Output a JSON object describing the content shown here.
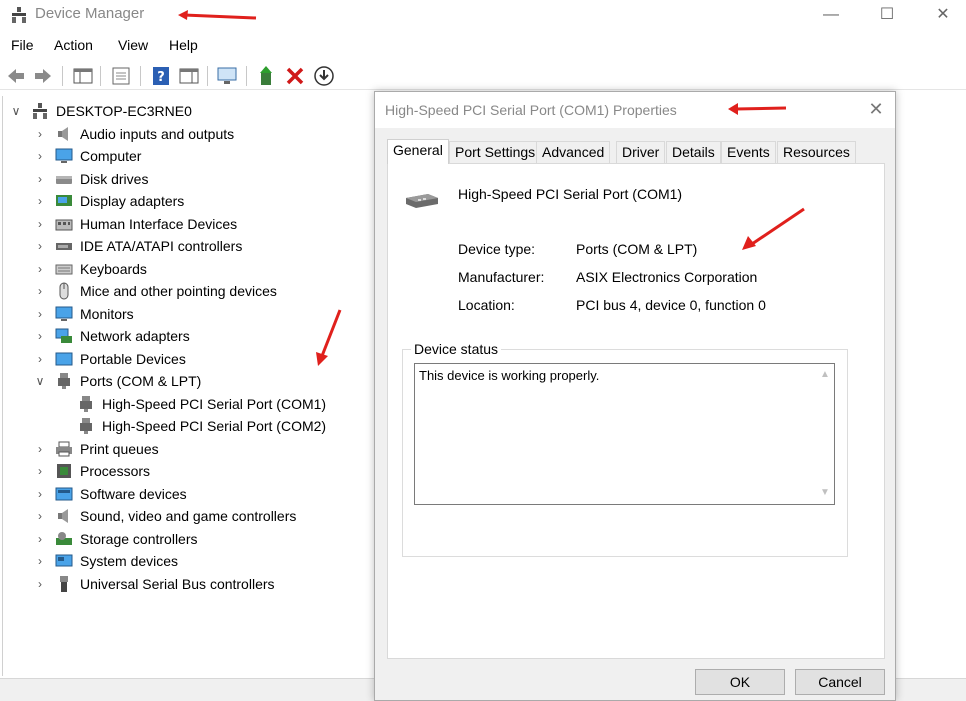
{
  "window": {
    "title": "Device Manager",
    "minimize_glyph": "—",
    "maximize_glyph": "☐",
    "close_glyph": "✕"
  },
  "menu": [
    "File",
    "Action",
    "View",
    "Help"
  ],
  "toolbar": {
    "icons": [
      "back-icon",
      "forward-icon",
      "show-hide-console-tree-icon",
      "properties-icon",
      "help-icon",
      "action-pane-icon",
      "display-icon",
      "update-driver-icon",
      "uninstall-icon",
      "scan-download-icon"
    ]
  },
  "tree": {
    "root": "DESKTOP-EC3RNE0",
    "items": [
      {
        "label": "Audio inputs and outputs",
        "icon": "speaker-icon",
        "expanded": false
      },
      {
        "label": "Computer",
        "icon": "computer-icon",
        "expanded": false
      },
      {
        "label": "Disk drives",
        "icon": "disk-drive-icon",
        "expanded": false
      },
      {
        "label": "Display adapters",
        "icon": "display-adapter-icon",
        "expanded": false
      },
      {
        "label": "Human Interface Devices",
        "icon": "hid-icon",
        "expanded": false
      },
      {
        "label": "IDE ATA/ATAPI controllers",
        "icon": "ide-controller-icon",
        "expanded": false
      },
      {
        "label": "Keyboards",
        "icon": "keyboard-icon",
        "expanded": false
      },
      {
        "label": "Mice and other pointing devices",
        "icon": "mouse-icon",
        "expanded": false
      },
      {
        "label": "Monitors",
        "icon": "monitor-icon",
        "expanded": false
      },
      {
        "label": "Network adapters",
        "icon": "network-adapter-icon",
        "expanded": false
      },
      {
        "label": "Portable Devices",
        "icon": "portable-device-icon",
        "expanded": false
      },
      {
        "label": "Ports (COM & LPT)",
        "icon": "port-icon",
        "expanded": true
      },
      {
        "label": "Print queues",
        "icon": "printer-icon",
        "expanded": false
      },
      {
        "label": "Processors",
        "icon": "processor-icon",
        "expanded": false
      },
      {
        "label": "Software devices",
        "icon": "software-device-icon",
        "expanded": false
      },
      {
        "label": "Sound, video and game controllers",
        "icon": "sound-icon",
        "expanded": false
      },
      {
        "label": "Storage controllers",
        "icon": "storage-controller-icon",
        "expanded": false
      },
      {
        "label": "System devices",
        "icon": "system-device-icon",
        "expanded": false
      },
      {
        "label": "Universal Serial Bus controllers",
        "icon": "usb-icon",
        "expanded": false
      }
    ],
    "ports_children": [
      "High-Speed PCI Serial Port (COM1)",
      "High-Speed PCI Serial Port (COM2)"
    ]
  },
  "dialog": {
    "title": "High-Speed PCI Serial Port (COM1) Properties",
    "close_glyph": "✕",
    "tabs": [
      "General",
      "Port Settings",
      "Advanced",
      "Driver",
      "Details",
      "Events",
      "Resources"
    ],
    "active_tab": "General",
    "device_name": "High-Speed PCI Serial Port (COM1)",
    "properties": [
      {
        "label": "Device type:",
        "value": "Ports (COM & LPT)"
      },
      {
        "label": "Manufacturer:",
        "value": "ASIX Electronics Corporation"
      },
      {
        "label": "Location:",
        "value": "PCI bus 4, device 0, function 0"
      }
    ],
    "status_legend": "Device status",
    "status_text": "This device is working properly.",
    "ok_label": "OK",
    "cancel_label": "Cancel"
  },
  "colors": {
    "annotation_arrow": "#e0201c",
    "selection": "#cce8ff",
    "help_blue": "#2b5fb3",
    "uninstall_red": "#d01818"
  }
}
